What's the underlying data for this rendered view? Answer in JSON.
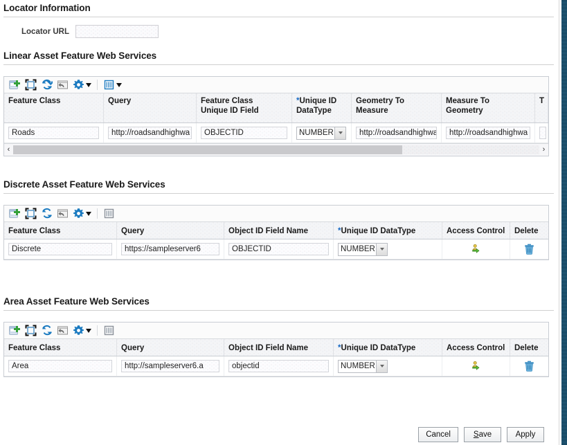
{
  "locator": {
    "section_title": "Locator Information",
    "url_label": "Locator URL",
    "url_value": "",
    "url_placeholder": ""
  },
  "linear": {
    "section_title": "Linear Asset Feature Web Services",
    "toolbar": {
      "add": "add-row-icon",
      "detach": "detach-icon",
      "refresh": "refresh-icon",
      "undo": "undo-icon",
      "settings": "gear-icon",
      "columns": "columns-icon"
    },
    "columns": [
      "Feature Class",
      "Query",
      "Feature Class Unique ID Field",
      "Unique ID DataType",
      "Geometry To Measure",
      "Measure To Geometry",
      "T"
    ],
    "required_columns": [
      "Unique ID DataType"
    ],
    "rows": [
      {
        "feature_class": "Roads",
        "query": "http://roadsandhighwa",
        "unique_id_field": "OBJECTID",
        "datatype": "NUMBER",
        "geometry_to_measure": "http://roadsandhighwa",
        "measure_to_geometry": "http://roadsandhighwa"
      }
    ],
    "scroll": {
      "left_arrow": "‹",
      "right_arrow": "›",
      "thumb_percent": 74
    }
  },
  "discrete": {
    "section_title": "Discrete Asset Feature Web Services",
    "columns": [
      "Feature Class",
      "Query",
      "Object ID Field Name",
      "Unique ID DataType",
      "Access Control",
      "Delete"
    ],
    "required_columns": [
      "Unique ID DataType"
    ],
    "rows": [
      {
        "feature_class": "Discrete",
        "query": "https://sampleserver6",
        "object_id_field": "OBJECTID",
        "datatype": "NUMBER",
        "access_control": "access-control-icon",
        "delete": "trash-icon"
      }
    ]
  },
  "area": {
    "section_title": "Area Asset Feature Web Services",
    "columns": [
      "Feature Class",
      "Query",
      "Object ID Field Name",
      "Unique ID DataType",
      "Access Control",
      "Delete"
    ],
    "required_columns": [
      "Unique ID DataType"
    ],
    "rows": [
      {
        "feature_class": "Area",
        "query": "http://sampleserver6.a",
        "object_id_field": "objectid",
        "datatype": "NUMBER",
        "access_control": "access-control-icon",
        "delete": "trash-icon"
      }
    ]
  },
  "footer": {
    "cancel": "Cancel",
    "save_prefix": "",
    "save_accesskey": "S",
    "save_suffix": "ave",
    "apply": "Apply"
  },
  "colors": {
    "accent_blue": "#1769c4",
    "icon_blue": "#1a7ac0",
    "required_star": "#1769c4",
    "header_bg": "#f4f5f7",
    "scrollbar_dark": "#1f4e68"
  }
}
